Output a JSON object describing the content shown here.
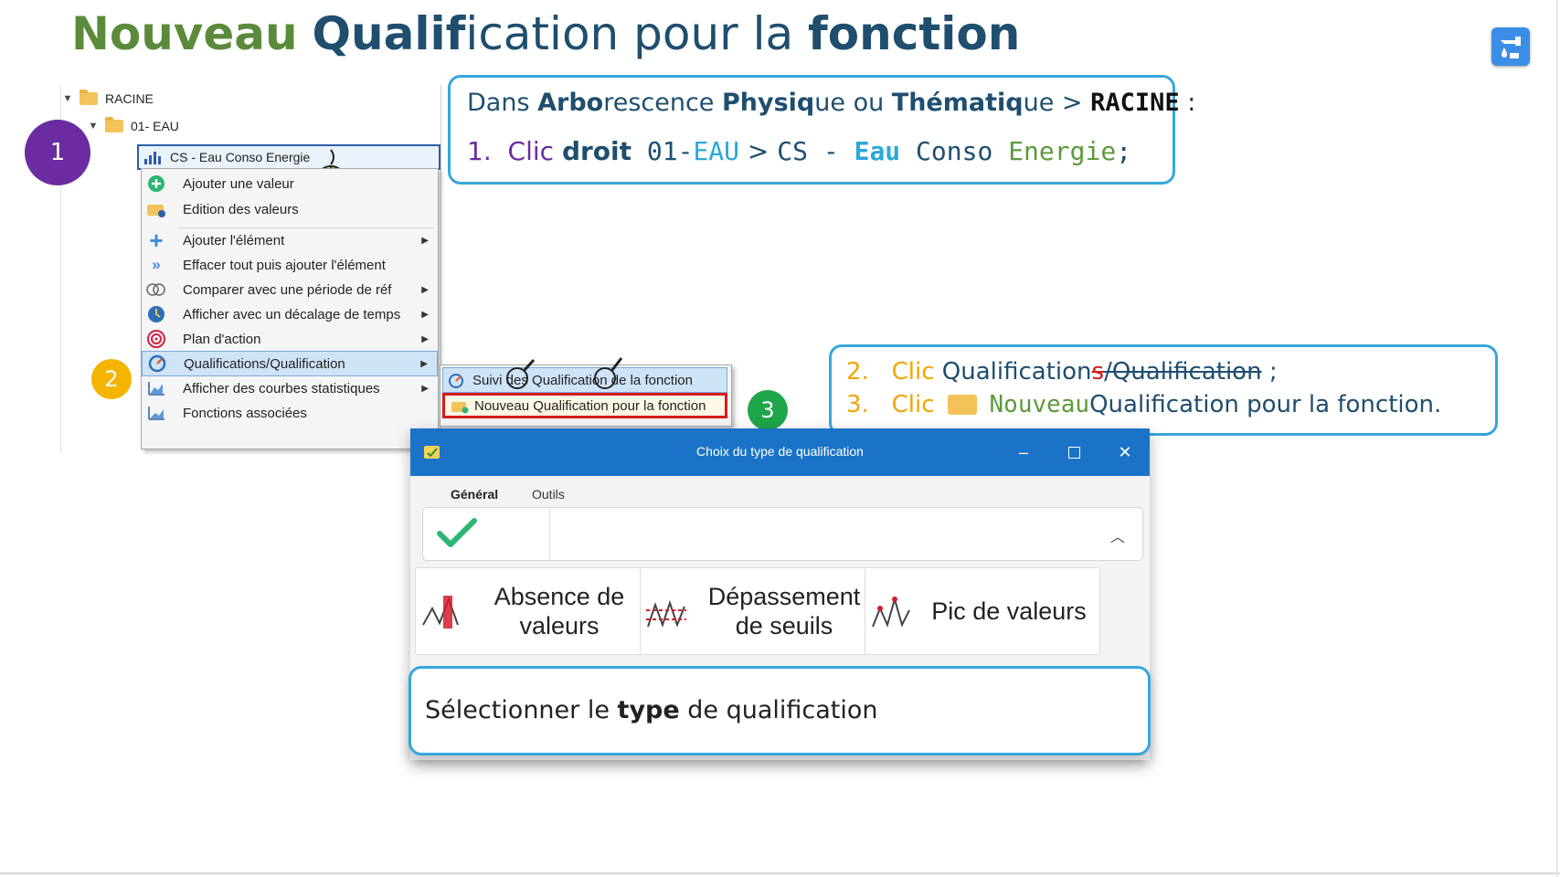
{
  "title": {
    "part1": "Nouveau",
    "part2": "Qualif",
    "part3": "ication pour la ",
    "part4": "fonction"
  },
  "tree": {
    "root": "RACINE",
    "child": "01- EAU",
    "selected_node": "CS - Eau Conso Energie"
  },
  "context_menu": {
    "items": [
      {
        "label": "Ajouter une valeur"
      },
      {
        "label": "Edition des valeurs"
      },
      {
        "label": "Ajouter l'élément"
      },
      {
        "label": "Effacer tout puis ajouter l'élément"
      },
      {
        "label": "Comparer avec une période de réf"
      },
      {
        "label": "Afficher avec un décalage de temps"
      },
      {
        "label": "Plan d'action"
      },
      {
        "label": "Qualifications/Qualification"
      },
      {
        "label": "Afficher des courbes statistiques"
      },
      {
        "label": "Fonctions associées"
      }
    ],
    "submenu": [
      {
        "label": "Suivi des Qualification de la fonction"
      },
      {
        "label": "Nouveau Qualification pour la fonction"
      }
    ]
  },
  "steps": [
    "1",
    "2",
    "3"
  ],
  "callout1": {
    "l1_a": "Dans ",
    "l1_b": "Arbo",
    "l1_c": "rescence ",
    "l1_d": "Physiq",
    "l1_e": "ue ou ",
    "l1_f": "Thématiq",
    "l1_g": "ue > ",
    "l1_h": "RACINE",
    "l1_i": " :",
    "l2_num": "1.",
    "l2_a": "Clic ",
    "l2_b": "droit",
    "l2_c": " 01-",
    "l2_d": "EAU",
    "l2_e": " > ",
    "l2_f": "CS - ",
    "l2_g": "Eau",
    "l2_h": " Conso ",
    "l2_i": "Energie",
    "l2_j": ";"
  },
  "callout2": {
    "l1_num": "2.",
    "l1_clic": "Clic",
    "l1_a": " Qualification",
    "l1_s": "s",
    "l1_b": "/Qualification",
    "l1_c": " ;",
    "l2_num": "3.",
    "l2_clic": "Clic",
    "l2_a": "Nouveau",
    "l2_b": " Qualification pour la fonction."
  },
  "dialog": {
    "title": "Choix du type de qualification",
    "tabs": [
      "Général",
      "Outils"
    ],
    "cards": [
      {
        "line1": "Absence de",
        "line2": "valeurs"
      },
      {
        "line1": "Dépassement",
        "line2": "de seuils"
      },
      {
        "line1": "Pic de valeurs",
        "line2": ""
      }
    ]
  },
  "callout3": {
    "a": "Sélectionner le ",
    "b": "type",
    "c": " de qualification"
  }
}
